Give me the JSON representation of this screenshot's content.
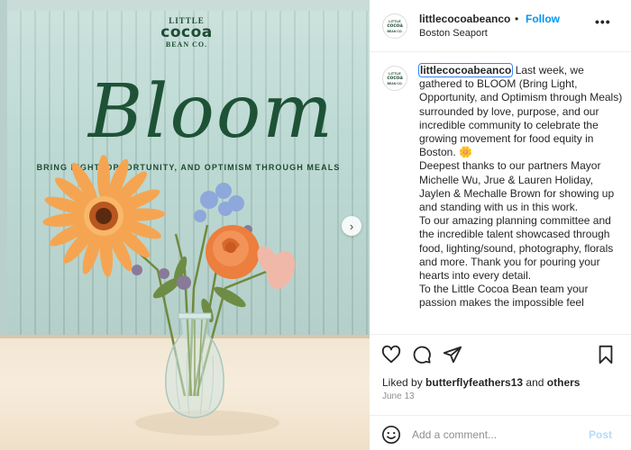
{
  "post": {
    "logo": {
      "line1": "LITTLE",
      "line2": "cocoa",
      "line3": "BEAN CO."
    },
    "headline": "Bloom",
    "tagline": "BRING LIGHT, OPPORTUNITY, AND OPTIMISM THROUGH MEALS",
    "next_arrow": "›"
  },
  "header": {
    "username": "littlecocoabeanco",
    "separator": "•",
    "follow_label": "Follow",
    "location": "Boston Seaport",
    "more_label": "•••"
  },
  "caption": {
    "username": "littlecocoabeanco",
    "paragraphs": [
      " Last week, we gathered to BLOOM (Bring Light, Opportunity, and Optimism through Meals) surrounded by love, purpose, and our incredible community to celebrate the growing movement for food equity in Boston. 🌼",
      "Deepest thanks to our partners Mayor Michelle Wu, Jrue & Lauren Holiday, Jaylen & Mechalle Brown for showing up and standing with us in this work.",
      "To our amazing planning committee and the incredible talent showcased through food, lighting/sound, photography, florals and more. Thank you for pouring your hearts into every detail.",
      "To the Little Cocoa Bean team your passion makes the impossible feel"
    ]
  },
  "actions": {
    "liked_by_prefix": "Liked by ",
    "liked_by_user": "butterflyfeathers13",
    "liked_by_and": " and ",
    "liked_by_others": "others",
    "date": "June 13",
    "comment_placeholder": "Add a comment...",
    "post_label": "Post"
  },
  "colors": {
    "brand_green": "#1f4b33",
    "follow_blue": "#0095f6",
    "post_disabled": "#b3dbff"
  }
}
